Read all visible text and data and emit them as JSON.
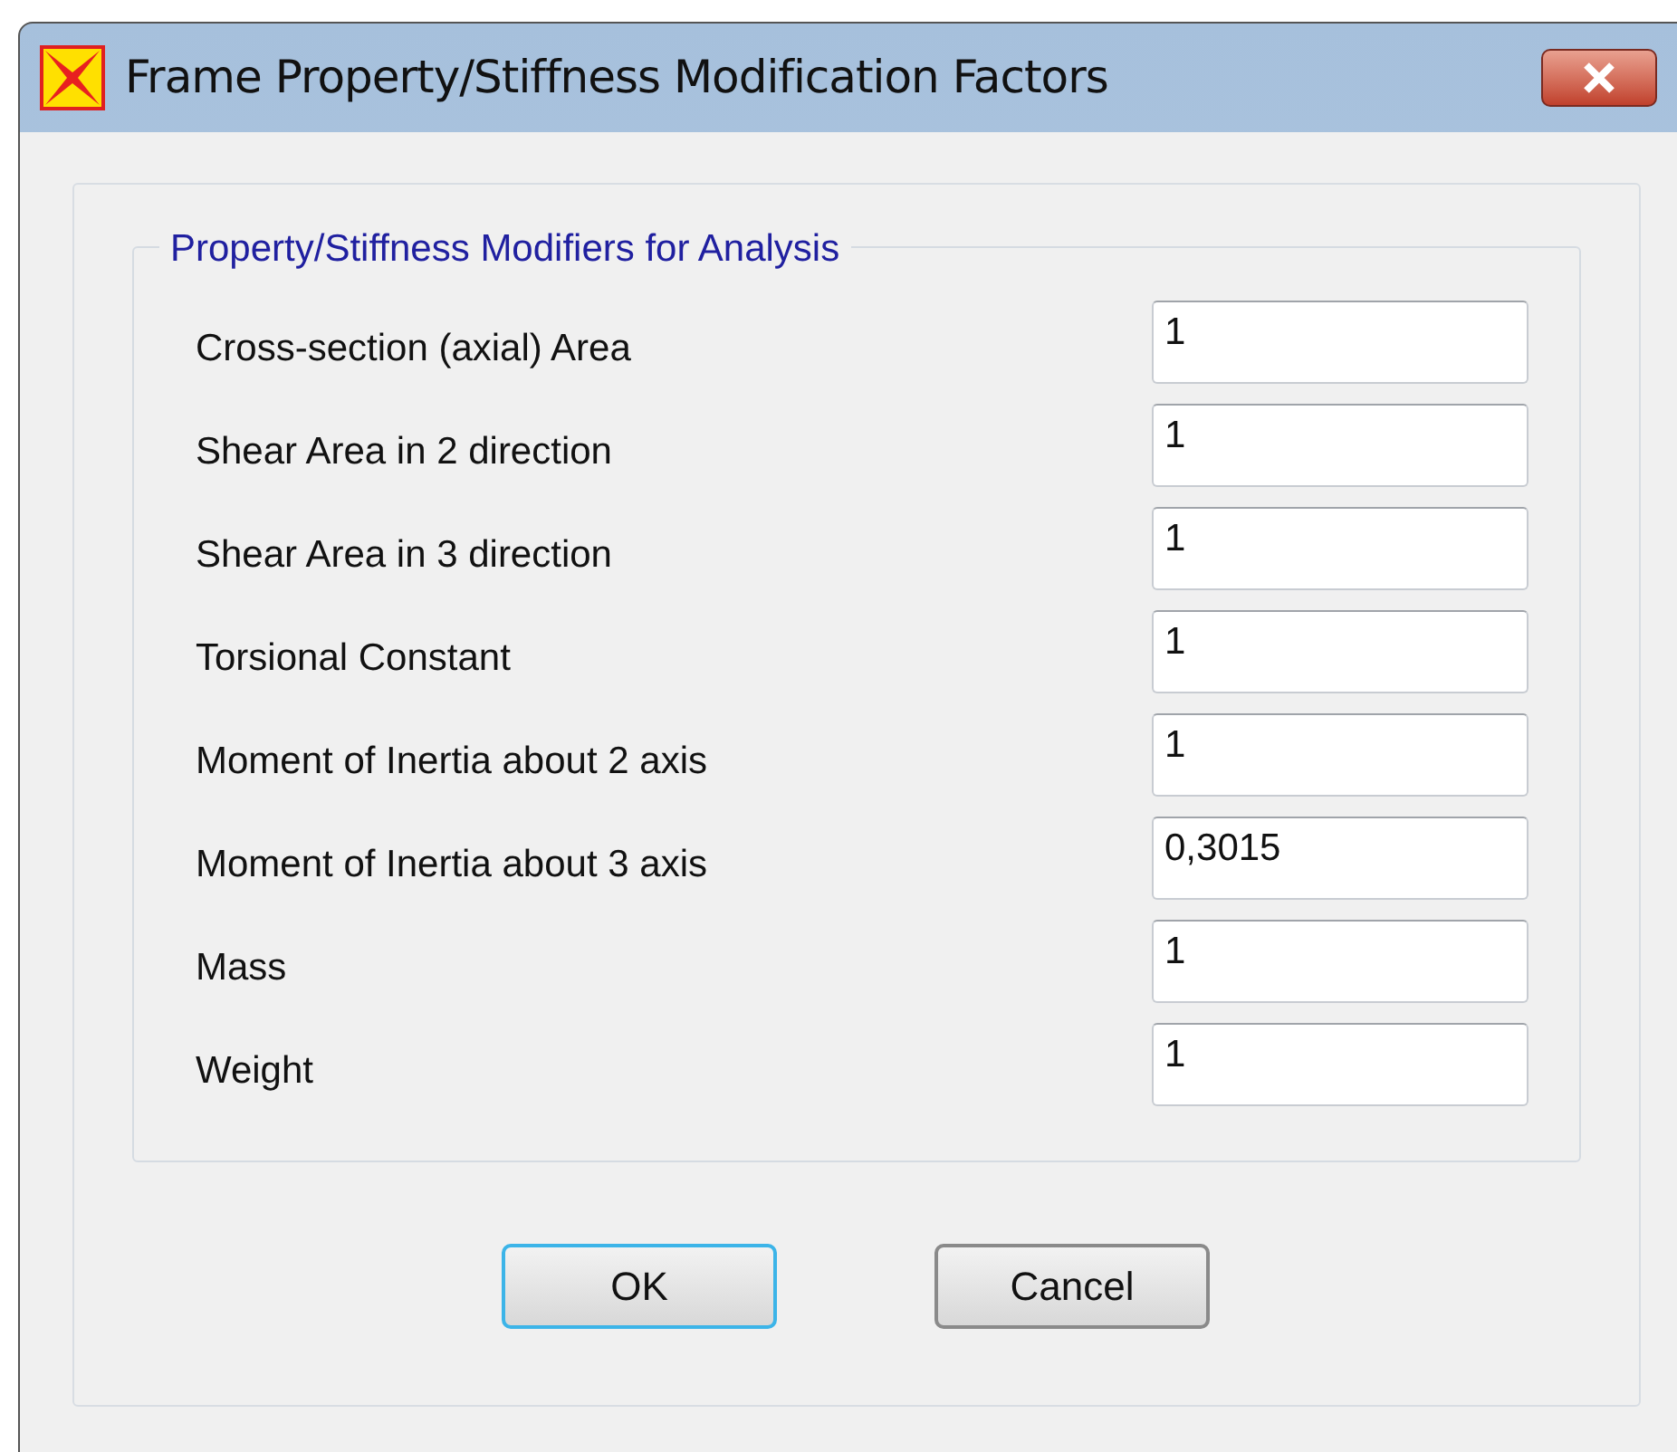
{
  "window": {
    "title": "Frame Property/Stiffness Modification Factors"
  },
  "group": {
    "title": "Property/Stiffness Modifiers for Analysis"
  },
  "fields": [
    {
      "label": "Cross-section (axial) Area",
      "value": "1"
    },
    {
      "label": "Shear Area in 2 direction",
      "value": "1"
    },
    {
      "label": "Shear Area in 3 direction",
      "value": "1"
    },
    {
      "label": "Torsional Constant",
      "value": "1"
    },
    {
      "label": "Moment of Inertia about 2 axis",
      "value": "1"
    },
    {
      "label": "Moment of Inertia about 3 axis",
      "value": "0,3015"
    },
    {
      "label": "Mass",
      "value": "1"
    },
    {
      "label": "Weight",
      "value": "1"
    }
  ],
  "buttons": [
    {
      "label": "OK",
      "selected": true
    },
    {
      "label": "Cancel",
      "selected": false
    }
  ]
}
